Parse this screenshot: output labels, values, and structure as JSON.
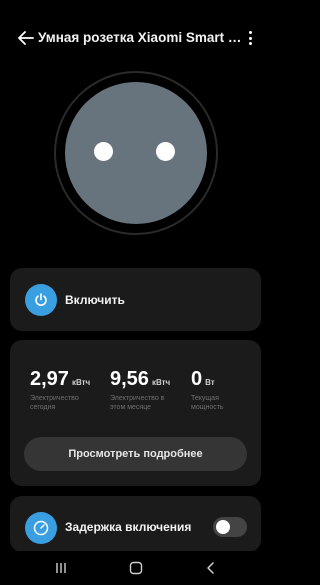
{
  "header": {
    "title": "Умная розетка Xiaomi Smart Pl...",
    "back_icon": "arrow-left-icon",
    "menu_icon": "more-vertical-icon"
  },
  "device": {
    "image": "smart-plug-socket-illustration",
    "face_color": "#67737d"
  },
  "power": {
    "label": "Включить",
    "icon": "power-icon",
    "accent": "#3a9fe0"
  },
  "stats": {
    "today": {
      "value": "2,97",
      "unit": "кВтч",
      "caption": "Электричество сегодня"
    },
    "month": {
      "value": "9,56",
      "unit": "кВтч",
      "caption": "Электричество в этом месяце"
    },
    "power": {
      "value": "0",
      "unit": "Вт",
      "caption": "Текущая мощность"
    },
    "details_label": "Просмотреть подробнее"
  },
  "delay": {
    "label": "Задержка включения",
    "icon": "timer-icon",
    "toggle_on": false
  },
  "navbar": {
    "recents_icon": "recents-icon",
    "home_icon": "home-icon",
    "back_icon": "nav-back-icon"
  }
}
